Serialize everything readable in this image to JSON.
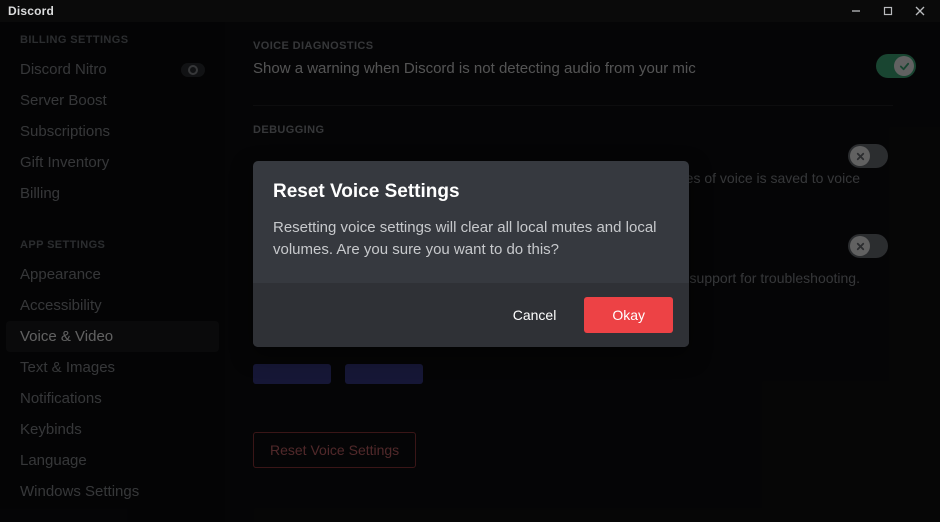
{
  "titlebar": {
    "brand": "Discord"
  },
  "sidebar": {
    "header_billing": "BILLING SETTINGS",
    "items_billing": [
      {
        "label": "Discord Nitro",
        "badge": true
      },
      {
        "label": "Server Boost"
      },
      {
        "label": "Subscriptions"
      },
      {
        "label": "Gift Inventory"
      },
      {
        "label": "Billing"
      }
    ],
    "header_app": "APP SETTINGS",
    "items_app": [
      {
        "label": "Appearance"
      },
      {
        "label": "Accessibility"
      },
      {
        "label": "Voice & Video",
        "active": true
      },
      {
        "label": "Text & Images"
      },
      {
        "label": "Notifications"
      },
      {
        "label": "Keybinds"
      },
      {
        "label": "Language"
      },
      {
        "label": "Windows Settings"
      }
    ]
  },
  "content": {
    "voice_diag_header": "VOICE DIAGNOSTICS",
    "voice_diag_text": "Show a warning when Discord is not detecting audio from your mic",
    "voice_diag_toggle_on": true,
    "debugging_header": "DEBUGGING",
    "debug_row1_trail": "five minutes of voice is saved to voice",
    "debug_row2_trail": "support for troubleshooting.",
    "reset_button": "Reset Voice Settings"
  },
  "modal": {
    "title": "Reset Voice Settings",
    "text": "Resetting voice settings will clear all local mutes and local volumes. Are you sure you want to do this?",
    "cancel": "Cancel",
    "okay": "Okay"
  },
  "colors": {
    "accent_green": "#43b581",
    "danger": "#ed4245",
    "blurple": "#5865f2"
  }
}
